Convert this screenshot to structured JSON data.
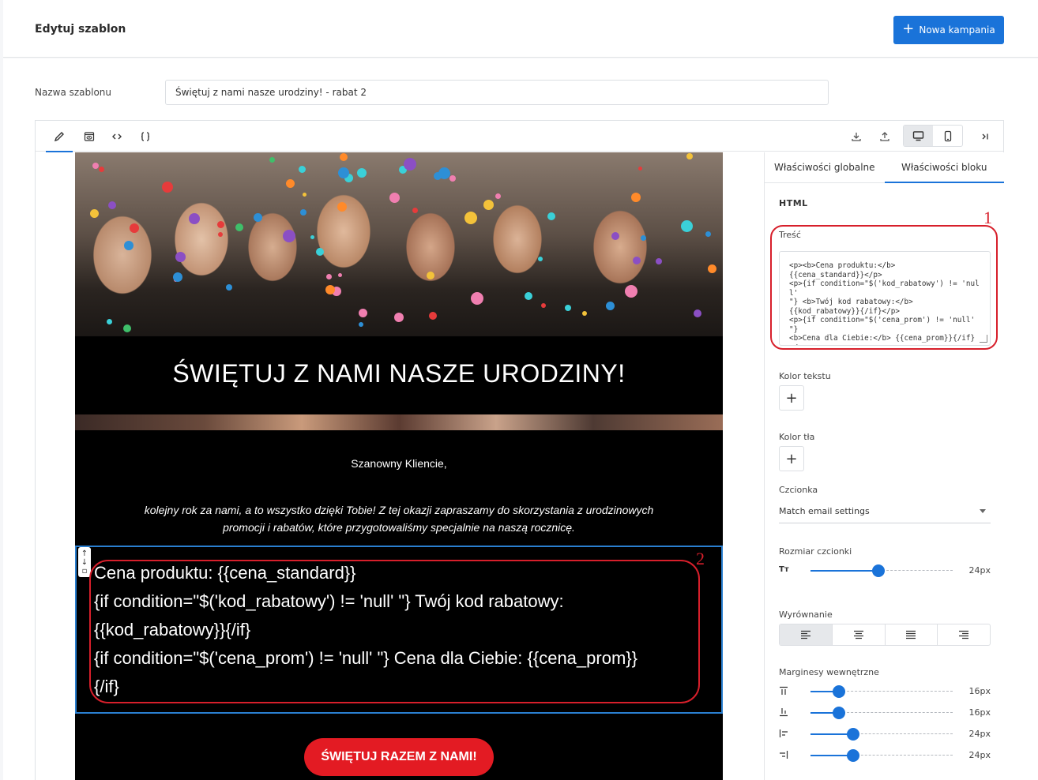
{
  "header": {
    "title": "Edytuj szablon",
    "new_campaign_label": "Nowa kampania"
  },
  "template": {
    "name_label": "Nazwa szablonu",
    "name_value": "Świętuj z nami nasze urodziny! - rabat 2"
  },
  "toolbar": {
    "icons": [
      "pencil-icon",
      "preview-icon",
      "code-icon",
      "braces-icon",
      "download-icon",
      "upload-icon",
      "desktop-icon",
      "mobile-icon",
      "collapse-panel-icon"
    ]
  },
  "email": {
    "banner_title": "ŚWIĘTUJ Z NAMI NASZE URODZINY!",
    "greeting": "Szanowny Kliencie,",
    "intro": "kolejny rok za nami, a to wszystko dzięki Tobie! Z tej okazji zapraszamy do skorzystania z urodzinowych promocji i rabatów, które przygotowaliśmy specjalnie na naszą rocznicę.",
    "html_lines": [
      "Cena produktu: {{cena_standard}}",
      "{if condition=\"$('kod_rabatowy') != 'null' \"} Twój kod rabatowy:",
      "{{kod_rabatowy}}{/if}",
      "{if condition=\"$('cena_prom') != 'null' \"} Cena dla Ciebie: {{cena_prom}}",
      "{/if}"
    ],
    "cta_label": "ŚWIĘTUJ RAZEM Z NAMI!"
  },
  "annotations": {
    "marker1": "1",
    "marker2": "2"
  },
  "panel": {
    "tab_global": "Właściwości globalne",
    "tab_block": "Właściwości bloku",
    "section_title": "HTML",
    "content_label": "Treść",
    "content_value": "<p><b>Cena produktu:</b>\n{{cena_standard}}</p>\n<p>{if condition=\"$('kod_rabatowy') != 'null'\n\"} <b>Twój kod rabatowy:</b>\n{{kod_rabatowy}}{/if}</p>\n<p>{if condition=\"$('cena_prom') != 'null' \"}\n<b>Cena dla Ciebie:</b> {{cena_prom}}{/if}</\np>",
    "text_color_label": "Kolor tekstu",
    "bg_color_label": "Kolor tła",
    "font_label": "Czcionka",
    "font_value": "Match email settings",
    "font_size_label": "Rozmiar czcionki",
    "font_size_value": "24px",
    "font_size_fraction": 0.48,
    "align_label": "Wyrównanie",
    "padding_label": "Marginesy wewnętrzne",
    "padding": [
      {
        "icon": "padding-top-icon",
        "value": "16px",
        "fraction": 0.2
      },
      {
        "icon": "padding-bottom-icon",
        "value": "16px",
        "fraction": 0.2
      },
      {
        "icon": "padding-left-icon",
        "value": "24px",
        "fraction": 0.3
      },
      {
        "icon": "padding-right-icon",
        "value": "24px",
        "fraction": 0.3
      }
    ]
  },
  "colors": {
    "accent": "#1a73d9",
    "cta": "#e31b23",
    "annotation": "#d71f2b"
  }
}
